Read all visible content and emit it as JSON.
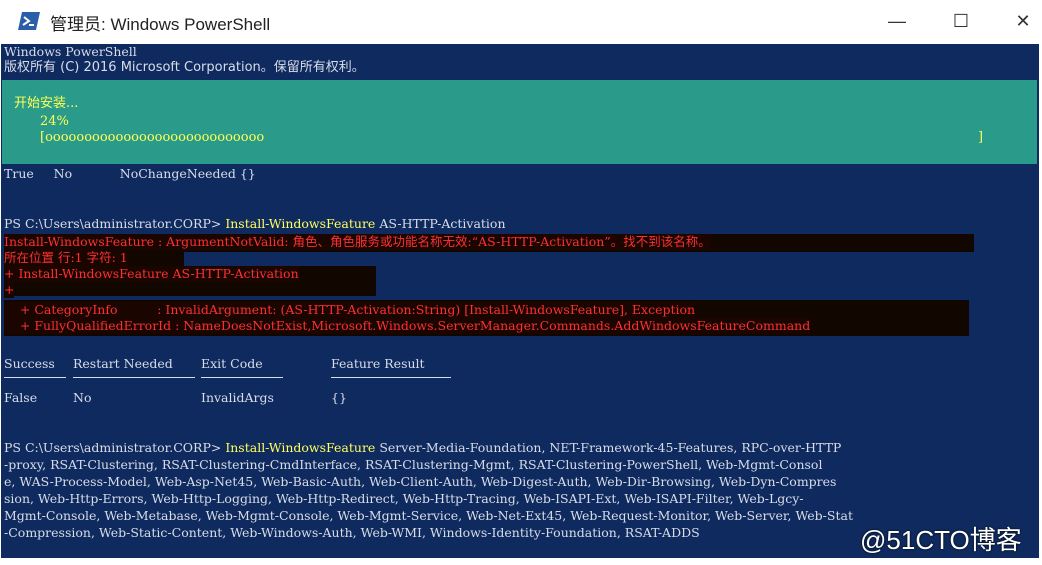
{
  "window": {
    "title": "管理员: Windows PowerShell",
    "minimize": "—",
    "maximize": "☐",
    "close": "✕"
  },
  "console": {
    "header_line1": "Windows PowerShell",
    "header_line2": "版权所有 (C) 2016 Microsoft Corporation。保留所有权利。",
    "progress_title": "开始安装...",
    "progress_percent": "24%",
    "progress_bar": "[oooooooooooooooooooooooooooo",
    "progress_bar_end": "]",
    "result1": "True     No            NoChangeNeeded {}",
    "prompt1": "PS C:\\Users\\administrator.CORP> ",
    "cmd1_name": "Install-WindowsFeature",
    "cmd1_args": " AS-HTTP-Activation",
    "err1": "Install-WindowsFeature : ArgumentNotValid: 角色、角色服务或功能名称无效:“AS-HTTP-Activation”。找不到该名称。",
    "err2": "所在位置 行:1 字符: 1",
    "err3": "+ Install-WindowsFeature AS-HTTP-Activation",
    "err4": "+",
    "err5": "    + CategoryInfo          : InvalidArgument: (AS-HTTP-Activation:String) [Install-WindowsFeature], Exception",
    "err6": "    + FullyQualifiedErrorId : NameDoesNotExist,Microsoft.Windows.ServerManager.Commands.AddWindowsFeatureCommand",
    "col_success": "Success",
    "col_restart": "Restart Needed",
    "col_exit": "Exit Code",
    "col_feature": "Feature Result",
    "row_success": "False",
    "row_restart": "No",
    "row_exit": "InvalidArgs",
    "row_feature": "{}",
    "prompt2": "PS C:\\Users\\administrator.CORP> ",
    "cmd2_name": "Install-WindowsFeature",
    "cmd2_l1": " Server-Media-Foundation, NET-Framework-45-Features, RPC-over-HTTP",
    "cmd2_l2": "-proxy, RSAT-Clustering, RSAT-Clustering-CmdInterface, RSAT-Clustering-Mgmt, RSAT-Clustering-PowerShell, Web-Mgmt-Consol",
    "cmd2_l3": "e, WAS-Process-Model, Web-Asp-Net45, Web-Basic-Auth, Web-Client-Auth, Web-Digest-Auth, Web-Dir-Browsing, Web-Dyn-Compres",
    "cmd2_l4": "sion, Web-Http-Errors, Web-Http-Logging, Web-Http-Redirect, Web-Http-Tracing, Web-ISAPI-Ext, Web-ISAPI-Filter, Web-Lgcy-",
    "cmd2_l5": "Mgmt-Console, Web-Metabase, Web-Mgmt-Console, Web-Mgmt-Service, Web-Net-Ext45, Web-Request-Monitor, Web-Server, Web-Stat",
    "cmd2_l6": "-Compression, Web-Static-Content, Web-Windows-Auth, Web-WMI, Windows-Identity-Foundation, RSAT-ADDS"
  },
  "watermark": "@51CTO博客",
  "colors": {
    "console_bg": "#0f2a5e",
    "progress_bg": "#2a9b8a",
    "progress_text": "#ffff55",
    "error_text": "#ff3030",
    "command_text": "#ffff60"
  }
}
